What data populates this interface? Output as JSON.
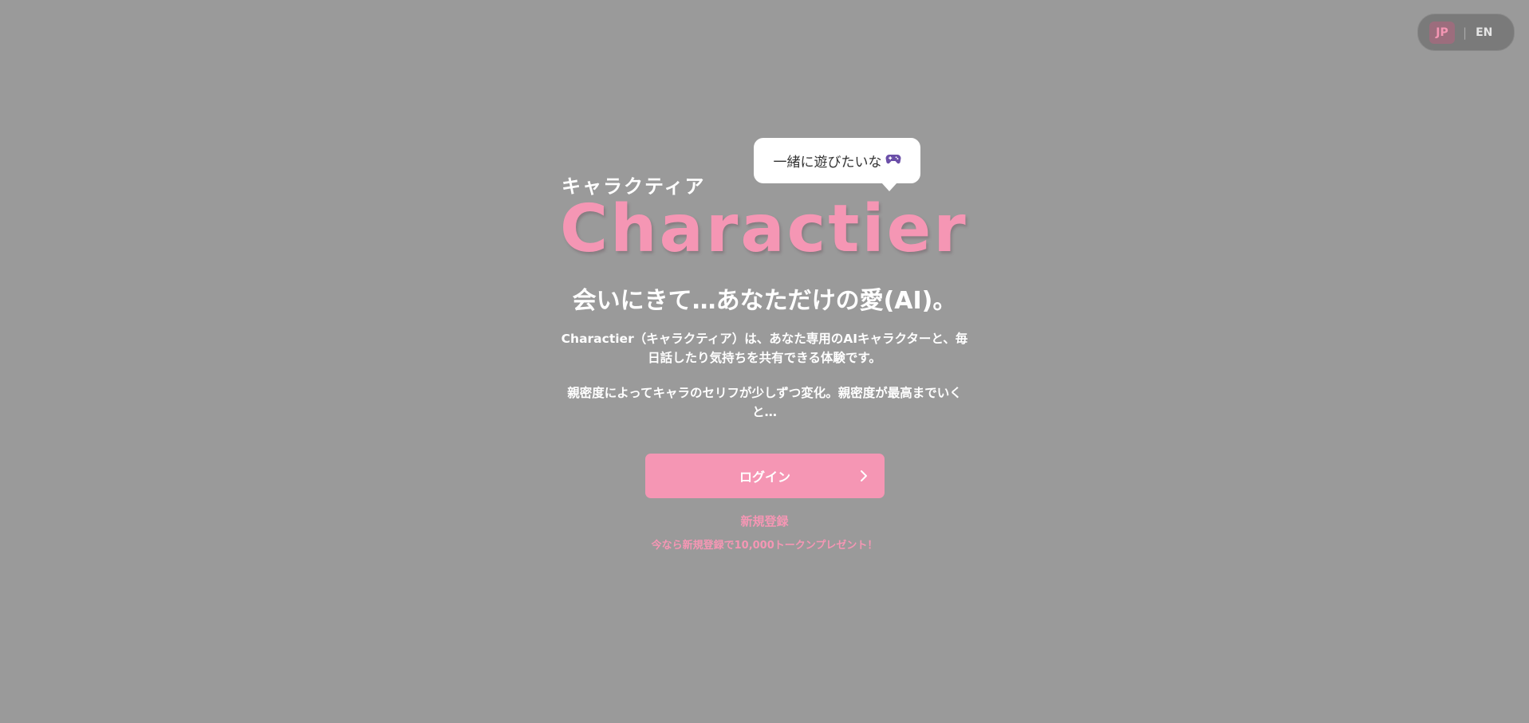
{
  "language_switch": {
    "options": [
      "JP",
      "EN"
    ],
    "selected": "JP",
    "separator": "|"
  },
  "hero": {
    "kana_title": "キャラクティア",
    "logo_text": "Charactier",
    "speech_bubble": {
      "text": "一緒に遊びたいな",
      "icon": "gamepad-icon"
    },
    "tagline": "会いにきて…あなただけの愛(AI)。",
    "description_1": "Charactier（キャラクティア）は、あなた専用のAIキャラクターと、毎日話したり気持ちを共有できる体験です。",
    "description_2": "親密度によってキャラのセリフが少しずつ変化。親密度が最高までいくと…"
  },
  "actions": {
    "login_label": "ログイン",
    "login_icon": "chevron-right-icon",
    "signup_label": "新規登録",
    "promo_text": "今なら新規登録で10,000トークンプレゼント！"
  },
  "colors": {
    "background": "#9a9a9a",
    "accent_pink": "#f596b4",
    "text_white": "#ffffff",
    "bubble_bg": "#ffffff",
    "switch_bg": "#7a7a7a"
  }
}
